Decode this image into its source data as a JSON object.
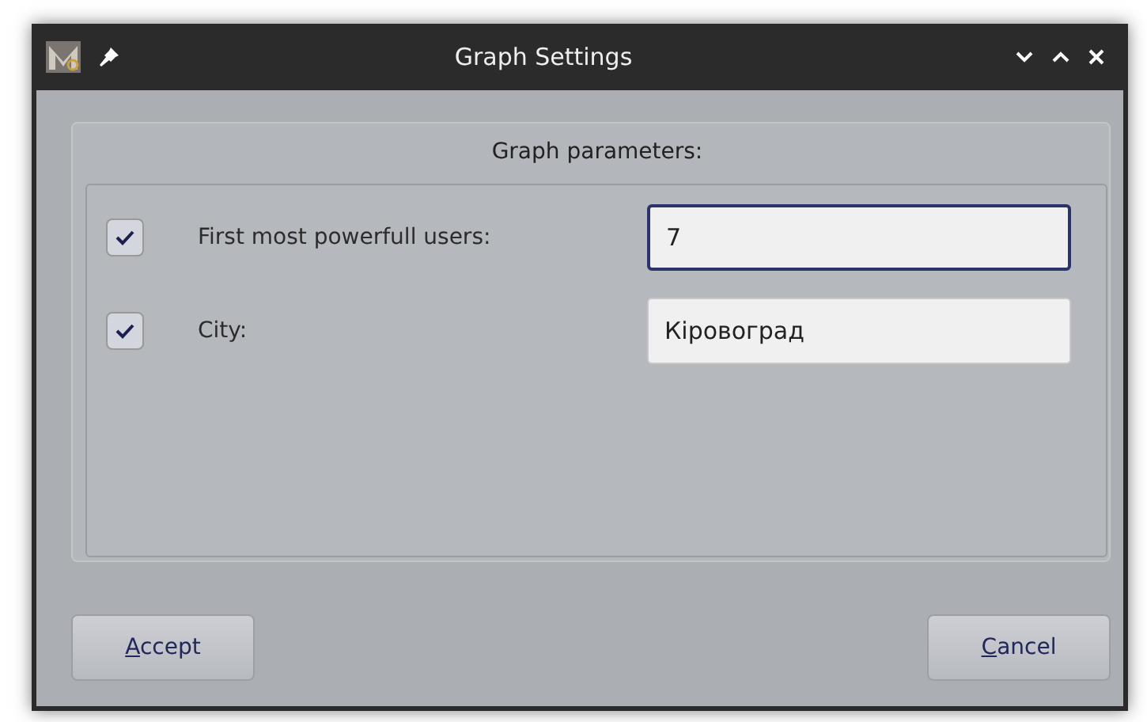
{
  "window": {
    "title": "Graph Settings"
  },
  "group": {
    "title": "Graph parameters:"
  },
  "rows": [
    {
      "checked": true,
      "label": "First most powerfull users:",
      "value": "7",
      "focused": true
    },
    {
      "checked": true,
      "label": "City:",
      "value": "Кіровоград",
      "focused": false
    }
  ],
  "buttons": [
    {
      "label": "Accept"
    },
    {
      "label": "Cancel"
    }
  ]
}
